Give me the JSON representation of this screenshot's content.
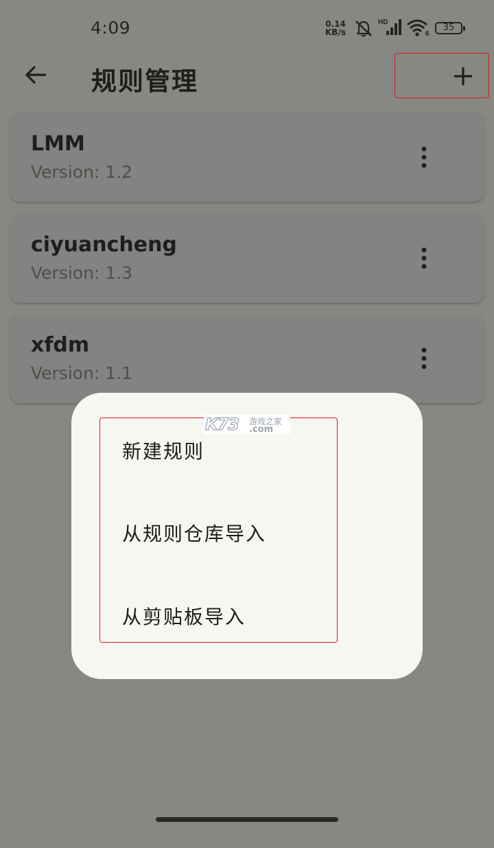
{
  "status_bar": {
    "time": "4:09",
    "net_speed_value": "0.14",
    "net_speed_unit": "KB/s",
    "network_label": "HD",
    "wifi_label": "6",
    "battery_level": "35",
    "icons": [
      "mute-bell-icon",
      "signal-icon",
      "wifi-icon",
      "battery-icon"
    ]
  },
  "app_bar": {
    "title": "规则管理",
    "back_icon": "arrow-left-icon",
    "add_icon": "plus-icon"
  },
  "rules": [
    {
      "name": "LMM",
      "version": "Version: 1.2"
    },
    {
      "name": "ciyuancheng",
      "version": "Version: 1.3"
    },
    {
      "name": "xfdm",
      "version": "Version: 1.1"
    }
  ],
  "menu": {
    "items": [
      "新建规则",
      "从规则仓库导入",
      "从剪贴板导入"
    ]
  },
  "watermark": {
    "logo": "K73",
    "sub": "游戏之家",
    "domain": ".com"
  },
  "colors": {
    "scrim_background": "#868983",
    "card_background": "#818480",
    "menu_background": "#f6f7f1",
    "highlight_border": "#e01818"
  }
}
